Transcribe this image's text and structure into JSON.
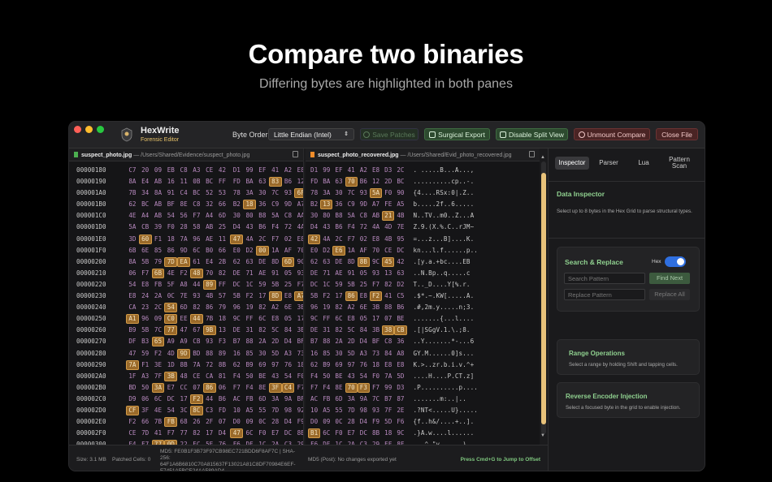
{
  "hero": {
    "title": "Compare two binaries",
    "subtitle": "Differing bytes are highlighted in both panes"
  },
  "app": {
    "name": "HexWrite",
    "subtitle": "Forensic Editor"
  },
  "toolbar": {
    "byte_order_label": "Byte Order",
    "byte_order_value": "Little Endian (Intel)",
    "save_patches": "Save Patches",
    "surgical_export": "Surgical Export",
    "disable_split": "Disable Split View",
    "unmount_compare": "Unmount Compare",
    "close_file": "Close File"
  },
  "left_pane": {
    "file_name": "suspect_photo.jpg",
    "sep": "—",
    "file_path": "/Users/Shared/Evidence/suspect_photo.jpg",
    "rows": [
      {
        "offset": "00000180",
        "bytes": [
          "C7",
          "20",
          "09",
          "EB",
          "C8",
          "A3",
          "CE",
          "42",
          "D1",
          "99",
          "EF",
          "41",
          "A2",
          "E8"
        ],
        "hl": []
      },
      {
        "offset": "00000190",
        "bytes": [
          "8A",
          "E4",
          "AB",
          "16",
          "11",
          "0B",
          "BC",
          "FF",
          "FD",
          "BA",
          "63",
          "83",
          "B6",
          "12"
        ],
        "hl": [
          11
        ]
      },
      {
        "offset": "000001A0",
        "bytes": [
          "7B",
          "34",
          "8A",
          "91",
          "C4",
          "BC",
          "52",
          "53",
          "78",
          "3A",
          "30",
          "7C",
          "93",
          "6F"
        ],
        "hl": [
          13
        ]
      },
      {
        "offset": "000001B0",
        "bytes": [
          "62",
          "BC",
          "AB",
          "BF",
          "8E",
          "C8",
          "32",
          "66",
          "B2",
          "18",
          "36",
          "C9",
          "9D",
          "A7"
        ],
        "hl": [
          9
        ]
      },
      {
        "offset": "000001C0",
        "bytes": [
          "4E",
          "A4",
          "AB",
          "54",
          "56",
          "F7",
          "A4",
          "6D",
          "30",
          "80",
          "B8",
          "5A",
          "C8",
          "AA"
        ],
        "hl": []
      },
      {
        "offset": "000001D0",
        "bytes": [
          "5A",
          "CB",
          "39",
          "F0",
          "28",
          "58",
          "AB",
          "25",
          "D4",
          "43",
          "B6",
          "F4",
          "72",
          "4A"
        ],
        "hl": []
      },
      {
        "offset": "000001E0",
        "bytes": [
          "3D",
          "60",
          "F1",
          "18",
          "7A",
          "96",
          "AE",
          "11",
          "47",
          "4A",
          "2C",
          "F7",
          "02",
          "E8"
        ],
        "hl": [
          1,
          8
        ]
      },
      {
        "offset": "000001F0",
        "bytes": [
          "6B",
          "6E",
          "85",
          "86",
          "9D",
          "6C",
          "B0",
          "66",
          "E0",
          "D2",
          "00",
          "1A",
          "AF",
          "70"
        ],
        "hl": [
          10
        ]
      },
      {
        "offset": "00000200",
        "bytes": [
          "8A",
          "5B",
          "79",
          "7D",
          "EA",
          "61",
          "E4",
          "2B",
          "62",
          "63",
          "DE",
          "8D",
          "6D",
          "9C"
        ],
        "hl": [
          3,
          4,
          12
        ]
      },
      {
        "offset": "00000210",
        "bytes": [
          "06",
          "F7",
          "6B",
          "4E",
          "F2",
          "48",
          "70",
          "82",
          "DE",
          "71",
          "AE",
          "91",
          "05",
          "93"
        ],
        "hl": [
          2,
          5
        ]
      },
      {
        "offset": "00000220",
        "bytes": [
          "54",
          "E8",
          "FB",
          "5F",
          "A8",
          "44",
          "89",
          "FF",
          "DC",
          "1C",
          "59",
          "5B",
          "25",
          "F7"
        ],
        "hl": [
          6
        ]
      },
      {
        "offset": "00000230",
        "bytes": [
          "E8",
          "24",
          "2A",
          "0C",
          "7E",
          "93",
          "4B",
          "57",
          "5B",
          "F2",
          "17",
          "8D",
          "E8",
          "A7"
        ],
        "hl": [
          11,
          13
        ]
      },
      {
        "offset": "00000240",
        "bytes": [
          "CA",
          "23",
          "2C",
          "54",
          "6D",
          "82",
          "86",
          "79",
          "96",
          "19",
          "82",
          "A2",
          "6E",
          "3B"
        ],
        "hl": [
          3
        ]
      },
      {
        "offset": "00000250",
        "bytes": [
          "A1",
          "96",
          "09",
          "C0",
          "EE",
          "44",
          "7B",
          "18",
          "9C",
          "FF",
          "6C",
          "E8",
          "05",
          "17"
        ],
        "hl": [
          0,
          3,
          5
        ]
      },
      {
        "offset": "00000260",
        "bytes": [
          "B9",
          "5B",
          "7C",
          "77",
          "47",
          "67",
          "9B",
          "13",
          "DE",
          "31",
          "82",
          "5C",
          "84",
          "3B"
        ],
        "hl": [
          3,
          6
        ]
      },
      {
        "offset": "00000270",
        "bytes": [
          "DF",
          "B3",
          "65",
          "A9",
          "A9",
          "CB",
          "93",
          "F3",
          "B7",
          "88",
          "2A",
          "2D",
          "D4",
          "BF"
        ],
        "hl": [
          2
        ]
      },
      {
        "offset": "00000280",
        "bytes": [
          "47",
          "59",
          "F2",
          "4D",
          "9D",
          "BD",
          "88",
          "89",
          "16",
          "85",
          "30",
          "5D",
          "A3",
          "73"
        ],
        "hl": [
          4
        ]
      },
      {
        "offset": "00000290",
        "bytes": [
          "7A",
          "F1",
          "3E",
          "1D",
          "8B",
          "7A",
          "72",
          "8B",
          "62",
          "B9",
          "69",
          "97",
          "76",
          "18"
        ],
        "hl": [
          0
        ]
      },
      {
        "offset": "000002A0",
        "bytes": [
          "1F",
          "A3",
          "7F",
          "3B",
          "48",
          "CE",
          "CA",
          "81",
          "F4",
          "50",
          "BE",
          "43",
          "54",
          "F0"
        ],
        "hl": [
          3
        ]
      },
      {
        "offset": "000002B0",
        "bytes": [
          "BD",
          "50",
          "3A",
          "E7",
          "CC",
          "07",
          "86",
          "06",
          "F7",
          "F4",
          "8E",
          "3F",
          "C4",
          "F7"
        ],
        "hl": [
          2,
          6,
          11,
          12
        ]
      },
      {
        "offset": "000002C0",
        "bytes": [
          "D9",
          "06",
          "6C",
          "DC",
          "17",
          "F2",
          "44",
          "B6",
          "AC",
          "FB",
          "6D",
          "3A",
          "9A",
          "BF"
        ],
        "hl": [
          5
        ]
      },
      {
        "offset": "000002D0",
        "bytes": [
          "CF",
          "3F",
          "4E",
          "54",
          "3C",
          "8C",
          "C3",
          "FD",
          "10",
          "A5",
          "55",
          "7D",
          "98",
          "92"
        ],
        "hl": [
          0,
          5
        ]
      },
      {
        "offset": "000002E0",
        "bytes": [
          "F2",
          "66",
          "7B",
          "FB",
          "68",
          "26",
          "2F",
          "07",
          "D0",
          "09",
          "0C",
          "28",
          "D4",
          "F9"
        ],
        "hl": [
          3
        ]
      },
      {
        "offset": "000002F0",
        "bytes": [
          "CE",
          "7D",
          "41",
          "F7",
          "77",
          "82",
          "17",
          "D4",
          "47",
          "6C",
          "F0",
          "E7",
          "DC",
          "8B"
        ],
        "hl": [
          8
        ]
      },
      {
        "offset": "00000300",
        "bytes": [
          "F4",
          "E7",
          "77",
          "0D",
          "22",
          "EC",
          "5E",
          "76",
          "F6",
          "DF",
          "1C",
          "2A",
          "C3",
          "29"
        ],
        "hl": [
          2,
          3
        ]
      },
      {
        "offset": "00000310",
        "bytes": [
          "EA",
          "44",
          "C1",
          "4B",
          "EE",
          "1D",
          "7B",
          "81",
          "5E",
          "FA",
          "D6",
          "85",
          "41"
        ],
        "hl": [
          4,
          10
        ]
      }
    ]
  },
  "right_pane": {
    "file_name": "suspect_photo_recovered.jpg",
    "sep": "—",
    "file_path": "/Users/Shared/Evid_photo_recovered.jpg",
    "rows": [
      {
        "bytes": [
          "D1",
          "99",
          "EF",
          "41",
          "A2",
          "E8",
          "D3",
          "2C"
        ],
        "hl": [],
        "ascii": ". .....B...A...,"
      },
      {
        "bytes": [
          "FD",
          "BA",
          "63",
          "70",
          "B6",
          "12",
          "2D",
          "BC"
        ],
        "hl": [
          3
        ],
        "ascii": "..........cp..-."
      },
      {
        "bytes": [
          "78",
          "3A",
          "30",
          "7C",
          "93",
          "5A",
          "F0",
          "90"
        ],
        "hl": [
          5
        ],
        "ascii": "{4....RSx:0|.Z.."
      },
      {
        "bytes": [
          "B2",
          "13",
          "36",
          "C9",
          "9D",
          "A7",
          "FE",
          "A5"
        ],
        "hl": [
          1
        ],
        "ascii": "b.....2f..6....."
      },
      {
        "bytes": [
          "30",
          "80",
          "B8",
          "5A",
          "C8",
          "AB",
          "21",
          "4B"
        ],
        "hl": [
          6
        ],
        "ascii": "N..TV..m0..Z...A"
      },
      {
        "bytes": [
          "D4",
          "43",
          "B6",
          "F4",
          "72",
          "4A",
          "4D",
          "7E"
        ],
        "hl": [],
        "ascii": "Z.9.(X.%.C..rJM~"
      },
      {
        "bytes": [
          "42",
          "4A",
          "2C",
          "F7",
          "02",
          "E8",
          "4B",
          "95"
        ],
        "hl": [
          0
        ],
        "ascii": "=...z...B]....K."
      },
      {
        "bytes": [
          "E0",
          "D2",
          "E6",
          "1A",
          "AF",
          "70",
          "CE",
          "DC"
        ],
        "hl": [
          2
        ],
        "ascii": "kn...l.f......p.."
      },
      {
        "bytes": [
          "62",
          "63",
          "DE",
          "8D",
          "8B",
          "9C",
          "45",
          "42"
        ],
        "hl": [
          4,
          6
        ],
        "ascii": ".[y.a.+bc....EB"
      },
      {
        "bytes": [
          "DE",
          "71",
          "AE",
          "91",
          "05",
          "93",
          "13",
          "63"
        ],
        "hl": [],
        "ascii": "..N.Bp..q.....c"
      },
      {
        "bytes": [
          "DC",
          "1C",
          "59",
          "5B",
          "25",
          "F7",
          "82",
          "D2"
        ],
        "hl": [],
        "ascii": "T.._D....Y[%.r."
      },
      {
        "bytes": [
          "5B",
          "F2",
          "17",
          "86",
          "E8",
          "F2",
          "41",
          "C5"
        ],
        "hl": [
          3,
          5
        ],
        "ascii": ".$*.~.KW[.....A."
      },
      {
        "bytes": [
          "96",
          "19",
          "82",
          "A2",
          "6E",
          "3B",
          "88",
          "B6"
        ],
        "hl": [],
        "ascii": ".#,2m.y.....n;3."
      },
      {
        "bytes": [
          "9C",
          "FF",
          "6C",
          "E8",
          "05",
          "17",
          "07",
          "BE"
        ],
        "hl": [],
        "ascii": ".......{...l...."
      },
      {
        "bytes": [
          "DE",
          "31",
          "82",
          "5C",
          "84",
          "3B",
          "38",
          "CB"
        ],
        "hl": [
          6,
          7
        ],
        "ascii": ".[|SGgV.1.\\.;8."
      },
      {
        "bytes": [
          "B7",
          "88",
          "2A",
          "2D",
          "D4",
          "BF",
          "C8",
          "36"
        ],
        "hl": [],
        "ascii": "..Y.......*-...6"
      },
      {
        "bytes": [
          "16",
          "85",
          "30",
          "5D",
          "A3",
          "73",
          "84",
          "A8"
        ],
        "hl": [],
        "ascii": "GY.M......0]s..."
      },
      {
        "bytes": [
          "62",
          "B9",
          "69",
          "97",
          "76",
          "18",
          "E8",
          "E8"
        ],
        "hl": [],
        "ascii": "K.>..zr.b.i.v.^+"
      },
      {
        "bytes": [
          "F4",
          "50",
          "BE",
          "43",
          "54",
          "F0",
          "7A",
          "5D"
        ],
        "hl": [],
        "ascii": "....H....P.CT.z]"
      },
      {
        "bytes": [
          "F7",
          "F4",
          "8E",
          "70",
          "F3",
          "F7",
          "99",
          "D3"
        ],
        "hl": [
          3,
          4
        ],
        "ascii": ".P..........p...."
      },
      {
        "bytes": [
          "AC",
          "FB",
          "6D",
          "3A",
          "9A",
          "7C",
          "B7",
          "87"
        ],
        "hl": [],
        "ascii": ".......m:..|.."
      },
      {
        "bytes": [
          "10",
          "A5",
          "55",
          "7D",
          "98",
          "93",
          "7F",
          "2E"
        ],
        "hl": [],
        "ascii": ".?NT<.....U}....."
      },
      {
        "bytes": [
          "D0",
          "09",
          "0C",
          "28",
          "D4",
          "F9",
          "5D",
          "F6"
        ],
        "hl": [],
        "ascii": "{f..h&/....+..]."
      },
      {
        "bytes": [
          "B1",
          "6C",
          "F0",
          "E7",
          "DC",
          "8B",
          "18",
          "9C"
        ],
        "hl": [
          0
        ],
        "ascii": ".}A.w....l......"
      },
      {
        "bytes": [
          "F6",
          "DF",
          "1C",
          "2A",
          "C3",
          "29",
          "EF",
          "8F"
        ],
        "hl": [],
        "ascii": "...^.\"v......)..."
      },
      {
        "bytes": [
          "81",
          "5E",
          "54",
          "D6",
          "85",
          "41",
          "03",
          "28"
        ],
        "hl": [
          2
        ],
        "ascii": ".D.K3....^T..A.("
      }
    ]
  },
  "status": {
    "size": "Size: 3.1 MB",
    "patched": "Patched Cells: 0",
    "md5": "MD5: FE0B1F3B73F97CB98EC721BDD6F8AF7C | SHA-256: 64F1A6B6810C70A815637F13021A81C8DF70984E6EF-F7451A5BCE24AA589AD4",
    "md5_post": "MD5 (Post): No changes exported yet",
    "jump_hint": "Press Cmd+G to Jump to Offset"
  },
  "sidebar": {
    "tabs": [
      "Inspector",
      "Parser",
      "Lua",
      "Pattern Scan"
    ],
    "data_inspector_title": "Data Inspector",
    "data_inspector_hint": "Select up to 8 bytes in the Hex Grid to parse structural types.",
    "search_replace_title": "Search & Replace",
    "hex_toggle_label": "Hex",
    "search_placeholder": "Search Pattern",
    "replace_placeholder": "Replace Pattern",
    "find_next": "Find Next",
    "replace_all": "Replace All",
    "range_ops_title": "Range Operations",
    "range_ops_hint": "Select a range by holding Shift and tapping cells.",
    "reverse_encoder_title": "Reverse Encoder Injection",
    "reverse_encoder_hint": "Select a focused byte in the grid to enable injection."
  },
  "colors": {
    "accent_green": "#8fd08f",
    "diff_highlight": "#9a6a2a",
    "byte_text": "#b98ac0",
    "toggle_blue": "#2f6fe0"
  }
}
